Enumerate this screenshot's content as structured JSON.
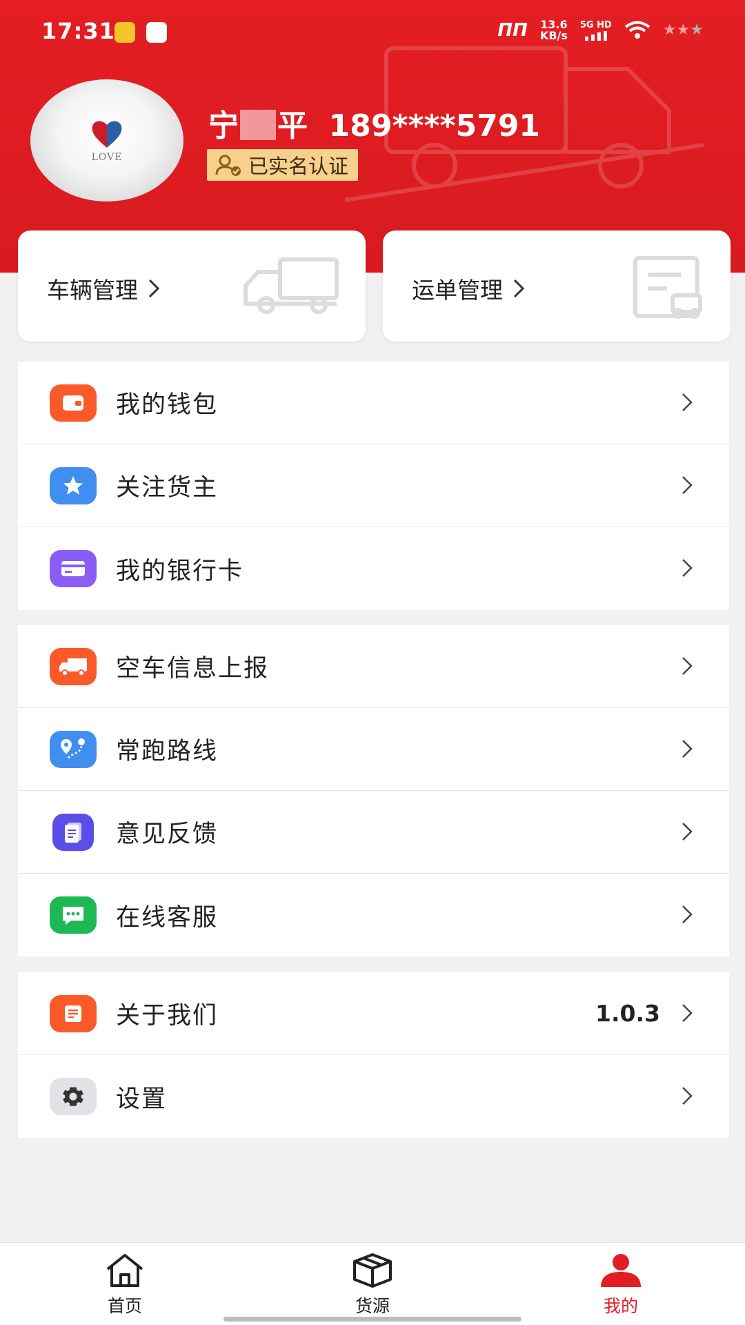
{
  "status_bar": {
    "time": "17:31",
    "net_speed_value": "13.6",
    "net_speed_unit": "KB/s",
    "signal_label": "5G HD"
  },
  "profile": {
    "name_first": "宁",
    "name_last": "平",
    "phone": "189****5791",
    "verified_label": "已实名认证",
    "avatar_text": "LOVE"
  },
  "cards": [
    {
      "label": "车辆管理"
    },
    {
      "label": "运单管理"
    }
  ],
  "menu_groups": [
    [
      {
        "label": "我的钱包",
        "icon": "wallet-icon",
        "color": "#fa5a2a"
      },
      {
        "label": "关注货主",
        "icon": "star-icon",
        "color": "#3f8ef0"
      },
      {
        "label": "我的银行卡",
        "icon": "bank-card-icon",
        "color": "#8b5cf6"
      }
    ],
    [
      {
        "label": "空车信息上报",
        "icon": "truck-icon",
        "color": "#fa5a2a"
      },
      {
        "label": "常跑路线",
        "icon": "route-icon",
        "color": "#3f8ef0"
      },
      {
        "label": "意见反馈",
        "icon": "feedback-icon",
        "color": "#5b4ee8"
      },
      {
        "label": "在线客服",
        "icon": "chat-icon",
        "color": "#1db954"
      }
    ],
    [
      {
        "label": "关于我们",
        "icon": "about-icon",
        "color": "#fa5a2a",
        "value": "1.0.3"
      },
      {
        "label": "设置",
        "icon": "gear-icon",
        "color": "#e2e2e6"
      }
    ]
  ],
  "tabs": [
    {
      "label": "首页",
      "icon": "home-icon"
    },
    {
      "label": "货源",
      "icon": "box-icon"
    },
    {
      "label": "我的",
      "icon": "user-icon",
      "active": true
    }
  ],
  "colors": {
    "brand": "#e21e24",
    "badge": "#f7d08c"
  }
}
